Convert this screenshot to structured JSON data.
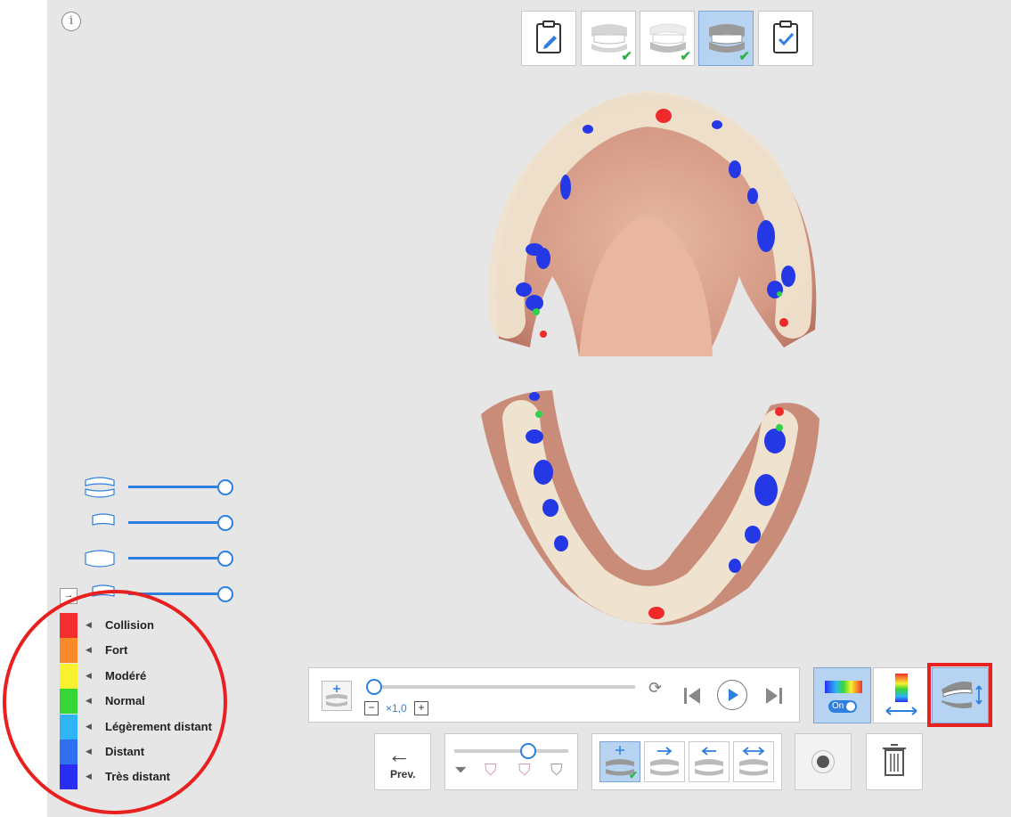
{
  "legend": {
    "items": [
      {
        "label": "Collision",
        "color": "#f42e2e"
      },
      {
        "label": "Fort",
        "color": "#f98a2a"
      },
      {
        "label": "Modéré",
        "color": "#f7f22d"
      },
      {
        "label": "Normal",
        "color": "#36d637"
      },
      {
        "label": "Légèrement distant",
        "color": "#2fb5f4"
      },
      {
        "label": "Distant",
        "color": "#2f70f0"
      },
      {
        "label": "Très distant",
        "color": "#2a2ef0"
      }
    ]
  },
  "playback": {
    "speed_label": "×1,0",
    "progress": 0
  },
  "footer": {
    "prev_label": "Prev."
  },
  "sliders": [
    {
      "icon": "both-jaws-icon",
      "value": 1.0
    },
    {
      "icon": "upper-jaw-icon",
      "value": 1.0
    },
    {
      "icon": "lower-jaw-icon",
      "value": 1.0
    },
    {
      "icon": "bite-icon",
      "value": 1.0
    }
  ],
  "color_map_toggle": {
    "state": "On"
  },
  "colors": {
    "accent": "#2f7fe0",
    "active_bg": "#b7d3f2",
    "highlight": "#e8201f",
    "check": "#2fb34a"
  }
}
